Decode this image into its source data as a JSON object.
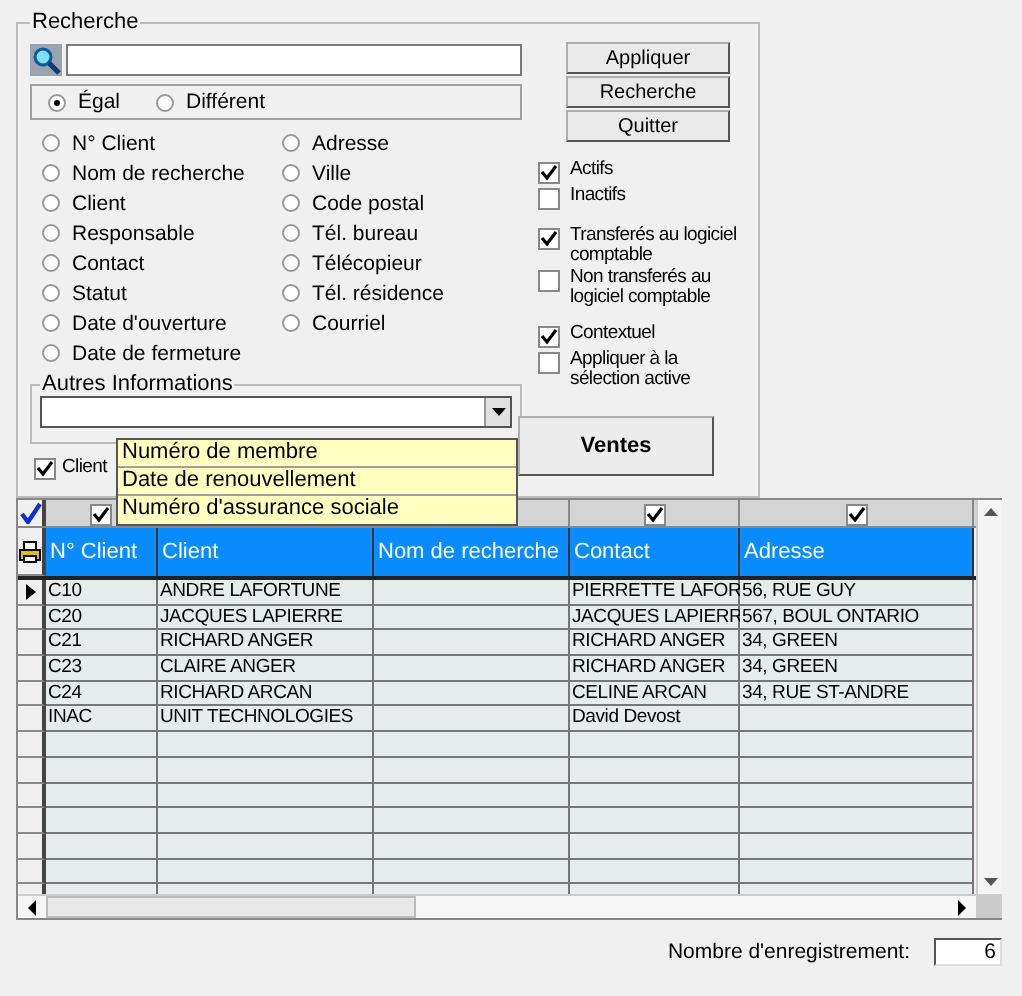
{
  "search": {
    "title": "Recherche",
    "match_modes": [
      {
        "label": "Égal",
        "selected": true
      },
      {
        "label": "Différent",
        "selected": false
      }
    ],
    "fields_left": [
      {
        "label": "N° Client",
        "selected": false
      },
      {
        "label": "Nom de recherche",
        "selected": false
      },
      {
        "label": "Client",
        "selected": false
      },
      {
        "label": "Responsable",
        "selected": false
      },
      {
        "label": "Contact",
        "selected": false
      },
      {
        "label": "Statut",
        "selected": false
      },
      {
        "label": "Date d'ouverture",
        "selected": false
      },
      {
        "label": "Date de fermeture",
        "selected": false
      }
    ],
    "fields_right": [
      {
        "label": "Adresse",
        "selected": false
      },
      {
        "label": "Ville",
        "selected": false
      },
      {
        "label": "Code postal",
        "selected": false
      },
      {
        "label": "Tél. bureau",
        "selected": false
      },
      {
        "label": "Télécopieur",
        "selected": false
      },
      {
        "label": "Tél. résidence",
        "selected": false
      },
      {
        "label": "Courriel",
        "selected": false
      }
    ],
    "other_info": {
      "title": "Autres Informations",
      "options": [
        "Numéro de membre",
        "Date de renouvellement",
        "Numéro d'assurance sociale"
      ]
    },
    "client_check": {
      "label": "Client",
      "checked": true
    },
    "buttons": [
      "Appliquer",
      "Recherche",
      "Quitter"
    ],
    "filter_groups": [
      [
        {
          "label": "Actifs",
          "checked": true
        },
        {
          "label": "Inactifs",
          "checked": false
        }
      ],
      [
        {
          "label": "Transferés au logiciel comptable",
          "checked": true
        },
        {
          "label": "Non transferés au logiciel comptable",
          "checked": false
        }
      ],
      [
        {
          "label": "Contextuel",
          "checked": true
        },
        {
          "label": "Appliquer à la sélection active",
          "checked": false
        }
      ]
    ],
    "sales_button": "Ventes"
  },
  "table": {
    "columns": [
      {
        "label": "N° Client",
        "filter_checked": true
      },
      {
        "label": "Client"
      },
      {
        "label": "Nom de recherche"
      },
      {
        "label": "Contact",
        "filter_checked": true
      },
      {
        "label": "Adresse",
        "filter_checked": true
      }
    ],
    "rows": [
      {
        "current": true,
        "cells": [
          "C10",
          "ANDRE LAFORTUNE",
          "",
          "PIERRETTE LAFOR",
          "56, RUE GUY"
        ]
      },
      {
        "current": false,
        "cells": [
          "C20",
          "JACQUES LAPIERRE",
          "",
          "JACQUES LAPIERR",
          "567, BOUL ONTARIO"
        ]
      },
      {
        "current": false,
        "cells": [
          "C21",
          "RICHARD ANGER",
          "",
          "RICHARD ANGER",
          "34, GREEN"
        ]
      },
      {
        "current": false,
        "cells": [
          "C23",
          "CLAIRE ANGER",
          "",
          "RICHARD ANGER",
          "34, GREEN"
        ]
      },
      {
        "current": false,
        "cells": [
          "C24",
          "RICHARD ARCAN",
          "",
          "CELINE ARCAN",
          "34, RUE ST-ANDRE"
        ]
      },
      {
        "current": false,
        "cells": [
          "INAC",
          "UNIT TECHNOLOGIES",
          "",
          "David Devost",
          ""
        ]
      }
    ]
  },
  "status": {
    "label": "Nombre d'enregistrement:",
    "value": "6"
  }
}
